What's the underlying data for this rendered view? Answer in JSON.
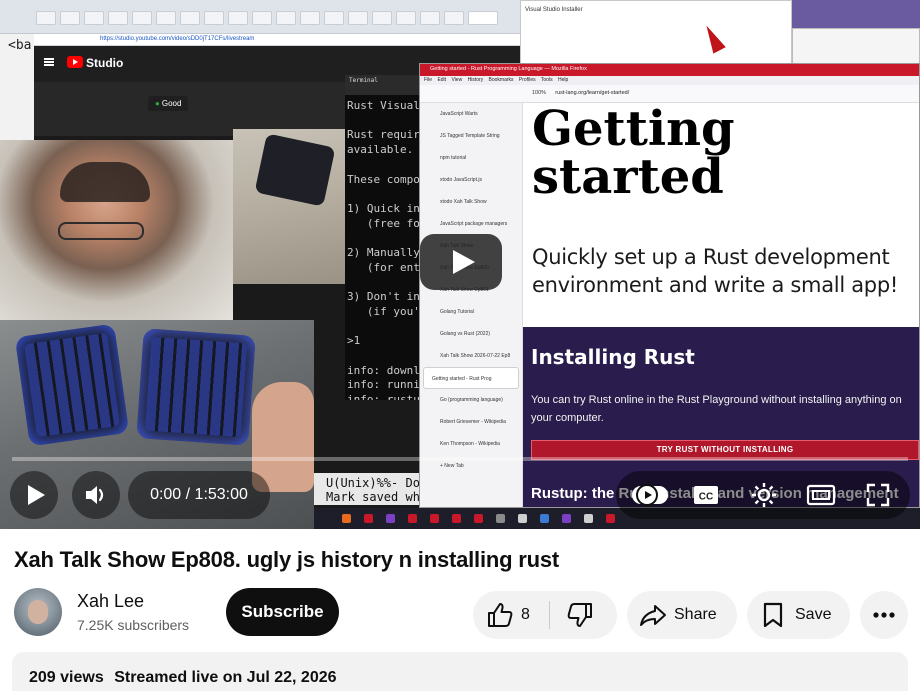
{
  "video_frame": {
    "desk_url": "https://studio.youtube.com/video/sDD0jT17CFs/livestream",
    "left_code": "<ba",
    "studio_label": "Studio",
    "good_badge": "Good",
    "terminal_title": "Terminal",
    "terminal_lines": "Rust Visual\n\nRust require\navailable.\n\nThese compon\n\n1) Quick ins\n   (free for\n\n2) Manually\n   (for ente\n\n3) Don't ins\n   (if you'r\n\n>1\n\ninfo: downlo\ninfo: runnin\ninfo: rustup",
    "emacs_lines": "U(Unix)%%- Do\nMark saved whe",
    "vs_installer_title": "Visual Studio Installer",
    "firefox": {
      "window_title": "Getting started - Rust Programming Language — Mozilla Firefox",
      "menu": "File Edit View History Bookmarks Profiles Tools Help",
      "zoom": "100%",
      "url": "rust-lang.org/learn/get-started/",
      "sidebar_items": [
        "JavaScript Warts",
        "JS Tagged Template String",
        "npm tutorial",
        "xtodo JavaScript.js",
        "xtodo Xah Talk Show",
        "JavaScript package managers",
        "Xah Talk Show",
        "Xah Talk Show Ep800",
        "Xah Talk Show Ep801",
        "Golang Tutorial",
        "Golang vs Rust (2022)",
        "Xah Talk Show 2026-07-22 Ep8",
        "Getting started - Rust Prog",
        "Go (programming language)",
        "Robert Griesemer - Wikipedia",
        "Ken Thompson - Wikipedia",
        "+ New Tab"
      ],
      "active_index": 12,
      "h1": "Getting started",
      "subtitle": "Quickly set up a Rust development environment and write a small app!",
      "h2": "Installing Rust",
      "paragraph": "You can try Rust online in the Rust Playground without installing anything on your computer.",
      "try_button": "TRY RUST WITHOUT INSTALLING",
      "h3": "Rustup: the Rust installer and version management"
    }
  },
  "player": {
    "time_display": "0:00 / 1:53:00",
    "progress": 0
  },
  "video": {
    "title": "Xah Talk Show Ep808. ugly js history n installing rust",
    "channel_name": "Xah Lee",
    "subscribers": "7.25K subscribers",
    "subscribe_label": "Subscribe",
    "like_count": "8",
    "share_label": "Share",
    "save_label": "Save",
    "views": "209 views",
    "streamed": "Streamed live on Jul 22, 2026"
  },
  "colors": {
    "accent_red": "#ff0000",
    "rust_purple": "#2a1d4d",
    "rust_button": "#b0172b"
  },
  "icons": {
    "play": "play-icon",
    "volume": "volume-icon",
    "autoplay": "autoplay-toggle-icon",
    "captions": "cc-icon",
    "settings": "gear-icon",
    "theater": "theater-mode-icon",
    "fullscreen": "fullscreen-icon",
    "like": "thumb-up-icon",
    "dislike": "thumb-down-icon",
    "share": "share-arrow-icon",
    "save": "bookmark-icon",
    "more": "more-horizontal-icon"
  }
}
